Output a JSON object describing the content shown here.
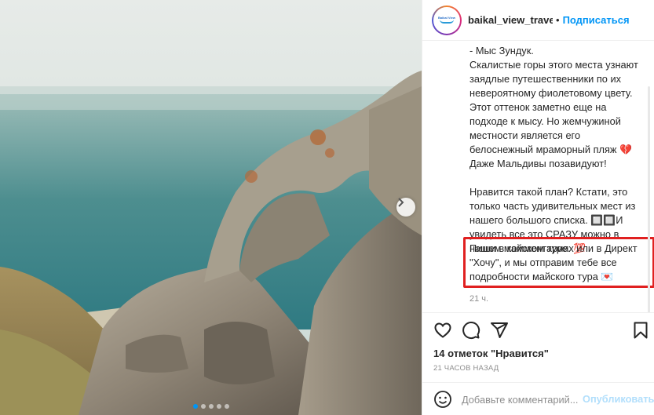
{
  "post": {
    "username": "baikal_view_travelle",
    "separator": "•",
    "follow_label": "Подписаться",
    "avatar_text": "Baikal View"
  },
  "caption": {
    "lines": [
      "- Мыс Зундук.",
      "Скалистые горы этого места узнают",
      "заядлые путешественники по их",
      "невероятному фиолетовому цвету.",
      "Этот оттенок заметно еще на",
      "подходе к мысу. Но жемчужиной",
      "местности является его",
      "белоснежный мраморный пляж 💔",
      "Даже Мальдивы позавидуют!",
      "",
      "Нравится такой план? Кстати, это",
      "только часть удивительных мест из",
      "нашего большого списка. 🔲🔲И",
      "увидеть все это СРАЗУ можно в",
      "нашем майском туре. 💯"
    ],
    "highlight_lines": [
      "Пиши в комментариях или в Директ",
      "\"Хочу\", и мы отправим тебе все",
      "подробности майского тура 💌"
    ],
    "comment_time": "21 ч."
  },
  "stats": {
    "likes": "14 отметок \"Нравится\"",
    "post_time": "21 ЧАСОВ НАЗАД"
  },
  "comment_box": {
    "placeholder": "Добавьте комментарий...",
    "publish_label": "Опубликовать"
  },
  "carousel": {
    "count": 5,
    "active_index": 0
  },
  "colors": {
    "accent": "#0095f6",
    "highlight_border": "#e02020",
    "publish_disabled": "#b2dffc"
  },
  "icons": [
    "heart-icon",
    "comment-icon",
    "share-icon",
    "bookmark-icon",
    "emoji-icon",
    "chevron-right-icon"
  ]
}
